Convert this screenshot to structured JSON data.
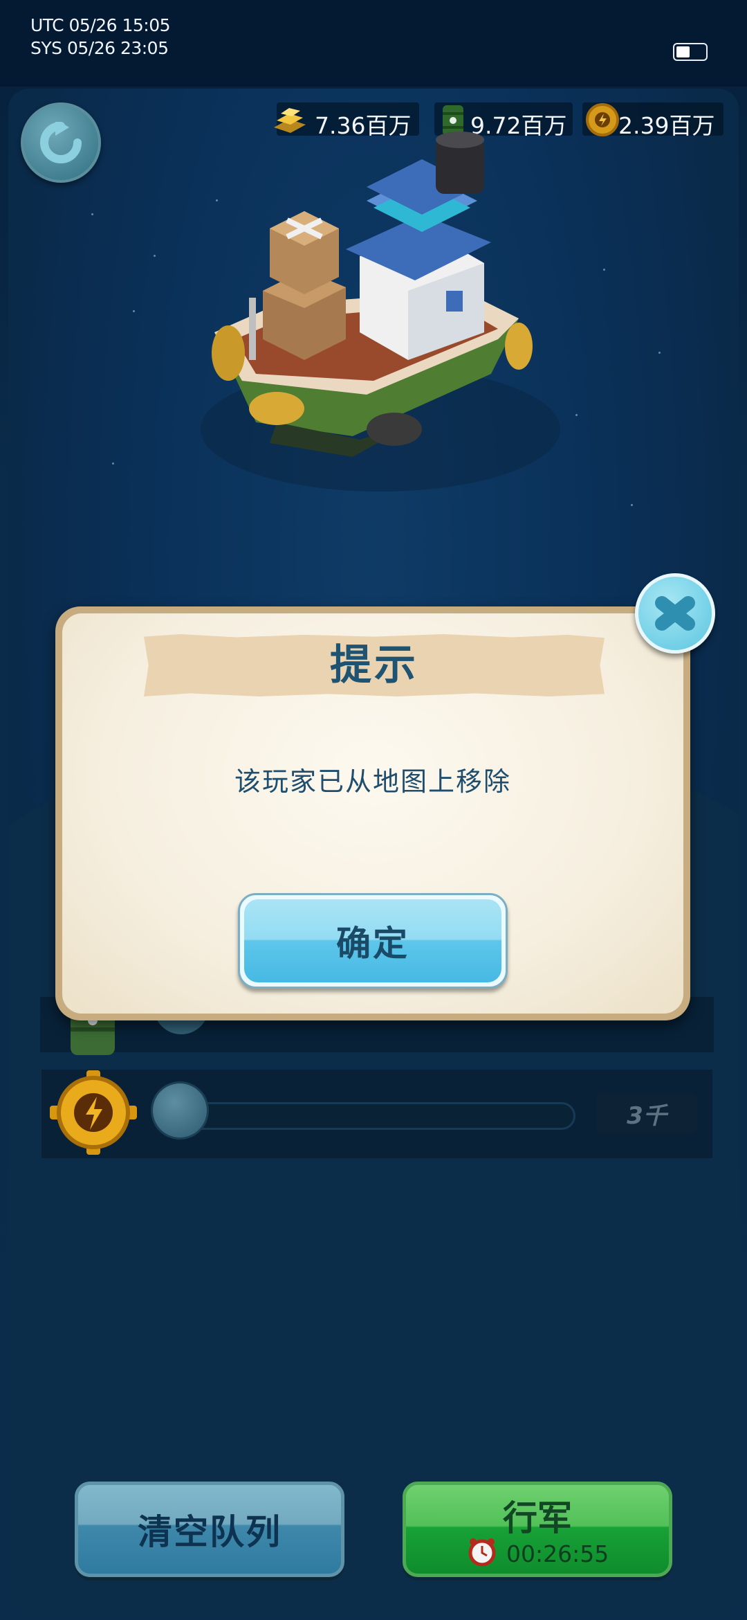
{
  "status_bar": {
    "utc_time": "UTC 05/26 15:05",
    "sys_time": "SYS 05/26 23:05",
    "battery_level": 0.45
  },
  "resources": [
    {
      "icon": "gold-bar-icon",
      "value": "7.36百万"
    },
    {
      "icon": "oil-barrel-icon",
      "value": "9.72百万"
    },
    {
      "icon": "gear-ore-icon",
      "value": "2.39百万"
    }
  ],
  "troop_slider": {
    "value": 0,
    "max_label": "3千"
  },
  "dialog": {
    "title": "提示",
    "message": "该玩家已从地图上移除",
    "confirm_label": "确定"
  },
  "bottom_bar": {
    "clear_queue_label": "清空队列",
    "march_label": "行军",
    "march_timer": "00:26:55"
  },
  "colors": {
    "ocean": "#0a3058",
    "dialog_border": "#c7ac80",
    "title_text": "#1f5372",
    "confirm_button": "#5ec6ea",
    "march_button": "#17a236",
    "clear_button": "#3f88ab"
  }
}
